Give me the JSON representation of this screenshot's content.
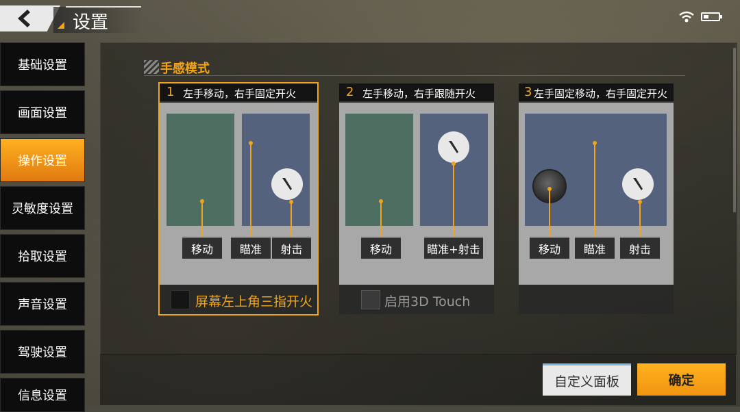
{
  "header": {
    "title": "设置",
    "back_icon": "back-arrow-icon",
    "status": {
      "wifi_icon": "wifi-icon",
      "battery_icon": "battery-icon",
      "battery_level": 0.35
    }
  },
  "sidebar": {
    "items": [
      {
        "label": "基础设置",
        "active": false
      },
      {
        "label": "画面设置",
        "active": false
      },
      {
        "label": "操作设置",
        "active": true
      },
      {
        "label": "灵敏度设置",
        "active": false
      },
      {
        "label": "拾取设置",
        "active": false
      },
      {
        "label": "声音设置",
        "active": false
      },
      {
        "label": "驾驶设置",
        "active": false
      },
      {
        "label": "信息设置",
        "active": false
      }
    ]
  },
  "main": {
    "section_title": "手感模式",
    "modes": [
      {
        "num": "1",
        "label": "左手移动，右手固定开火",
        "selected": true,
        "chips": [
          "移动",
          "瞄准",
          "射击"
        ],
        "footer": {
          "checkbox_label": "屏幕左上角三指开火",
          "enabled": true
        }
      },
      {
        "num": "2",
        "label": "左手移动，右手跟随开火",
        "selected": false,
        "chips": [
          "移动",
          "瞄准+射击"
        ],
        "footer": {
          "checkbox_label": "启用3D Touch",
          "enabled": false
        }
      },
      {
        "num": "3",
        "label": "左手固定移动，右手固定开火",
        "selected": false,
        "chips": [
          "移动",
          "瞄准",
          "射击"
        ],
        "footer": {
          "checkbox_label": "",
          "enabled": false
        }
      }
    ]
  },
  "actions": {
    "custom_label": "自定义面板",
    "confirm_label": "确定"
  },
  "colors": {
    "accent": "#f2a519",
    "active_tab": "#ffb020",
    "zone_move": "#4e6e62",
    "zone_aim": "#54627e"
  }
}
